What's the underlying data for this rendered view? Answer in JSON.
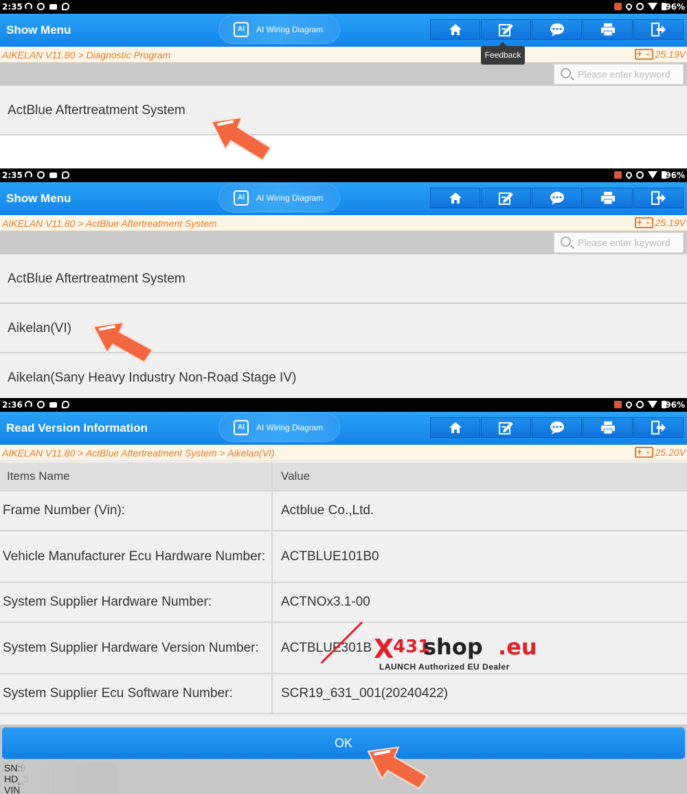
{
  "status": {
    "p1_time": "2:35",
    "p2_time": "2:35",
    "p3_time": "2:36",
    "battery": "96%"
  },
  "panel1": {
    "title": "Show Menu",
    "ai_label": "AI Wiring Diagram",
    "breadcrumb": "AIKELAN  V11.80 > Diagnostic Program",
    "voltage": "25.19V",
    "search_placeholder": "Please enter keyword",
    "tooltip": "Feedback",
    "items": [
      "ActBlue Aftertreatment System"
    ]
  },
  "panel2": {
    "title": "Show Menu",
    "ai_label": "AI Wiring Diagram",
    "breadcrumb": "AIKELAN  V11.80 > ActBlue Aftertreatment System",
    "voltage": "25.19V",
    "search_placeholder": "Please enter keyword",
    "items": [
      "ActBlue Aftertreatment System",
      "Aikelan(VI)",
      "Aikelan(Sany Heavy Industry Non-Road Stage IV)"
    ]
  },
  "panel3": {
    "title": "Read Version Information",
    "ai_label": "AI Wiring Diagram",
    "breadcrumb": "AIKELAN  V11.80 > ActBlue Aftertreatment System > Aikelan(VI)",
    "voltage": "25.20V",
    "table": {
      "headers": [
        "Items Name",
        "Value"
      ],
      "rows": [
        [
          "Frame Number (Vin):",
          "Actblue Co.,Ltd."
        ],
        [
          "Vehicle Manufacturer Ecu Hardware Number:",
          "ACTBLUE101B0"
        ],
        [
          "System Supplier Hardware Number:",
          "ACTNOx3.1-00"
        ],
        [
          "System Supplier Hardware Version Number:",
          "ACTBLUE301B"
        ],
        [
          "System Supplier Ecu Software Number:",
          "SCR19_631_001(20240422)"
        ]
      ]
    },
    "ok_label": "OK",
    "device_info": [
      "SN:9",
      "HD_5",
      "VIN"
    ]
  },
  "watermark": {
    "x": "X",
    "num": "431",
    "shop": "shop",
    "eu": ".eu",
    "tagline": "LAUNCH Authorized EU Dealer"
  },
  "icons": {
    "toolbar": [
      "home-icon",
      "edit-icon",
      "chat-icon",
      "print-icon",
      "exit-icon"
    ]
  },
  "colors": {
    "titlebar": "#1383e8",
    "breadcrumb_text": "#e07b2c",
    "arrow": "#f2673f",
    "watermark_red": "#e0202a"
  }
}
